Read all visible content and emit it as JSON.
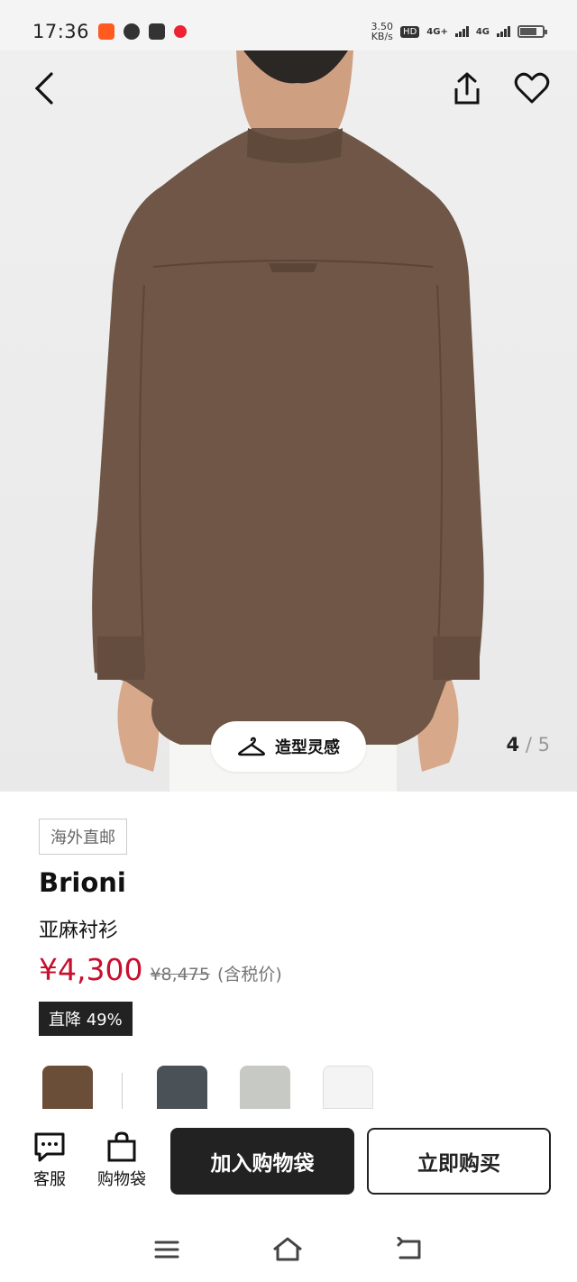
{
  "status_bar": {
    "time": "17:36",
    "net_speed_value": "3.50",
    "net_speed_unit": "KB/s",
    "hd_label": "HD",
    "sim1": "4G+",
    "sim2": "4G",
    "battery_level": 0.75
  },
  "gallery": {
    "current": "4",
    "total": "5",
    "styling_label": "造型灵感"
  },
  "product": {
    "tag": "海外直邮",
    "brand": "Brioni",
    "name": "亚麻衬衫",
    "price": "¥4,300",
    "original_price": "¥8,475",
    "tax_note": "(含税价)",
    "discount": "直降 49%",
    "variants": [
      {
        "color": "#6b4e38"
      },
      {
        "color": "#4a5257"
      },
      {
        "color": "#c7c9c4"
      },
      {
        "color": "#f4f4f4"
      }
    ]
  },
  "actions": {
    "customer_service": "客服",
    "shopping_bag": "购物袋",
    "add_to_bag": "加入购物袋",
    "buy_now": "立即购买"
  },
  "colors": {
    "price_red": "#c8102e",
    "shirt_brown": "#6f5646"
  }
}
